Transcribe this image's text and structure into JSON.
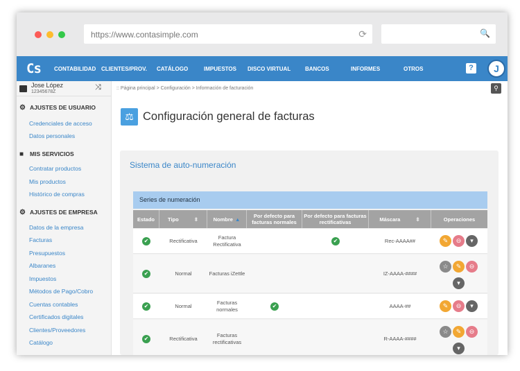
{
  "browser": {
    "url": "https://www.contasimple.com"
  },
  "nav": {
    "logo": "Cs",
    "items": [
      "CONTABILIDAD",
      "CLIENTES/PROV.",
      "CATÁLOGO",
      "IMPUESTOS",
      "DISCO VIRTUAL",
      "BANCOS",
      "INFORMES",
      "OTROS"
    ],
    "help": "?",
    "avatar": "J"
  },
  "user": {
    "name": "Jose López",
    "id": "12345678Z"
  },
  "sidebar": {
    "s1": "AJUSTES DE USUARIO",
    "s1_items": [
      "Credenciales de acceso",
      "Datos personales"
    ],
    "s2": "MIS SERVICIOS",
    "s2_items": [
      "Contratar productos",
      "Mis productos",
      "Histórico de compras"
    ],
    "s3": "AJUSTES DE EMPRESA",
    "s3_items": [
      "Datos de la empresa",
      "Facturas",
      "Presupuestos",
      "Albaranes",
      "Impuestos",
      "Métodos de Pago/Cobro",
      "Cuentas contables",
      "Certificados digitales",
      "Clientes/Proveedores",
      "Catálogo"
    ]
  },
  "breadcrumb": ":: Página principal > Configuración > Información de facturación",
  "page_title": "Configuración general de facturas",
  "panel": {
    "title": "Sistema de auto-numeración",
    "table_title": "Series de numeración",
    "headers": [
      "Estado",
      "Tipo",
      "Nombre",
      "Por defecto para facturas normales",
      "Por defecto para facturas rectificativas",
      "Máscara",
      "Operaciones"
    ],
    "rows": [
      {
        "tipo": "Rectificativa",
        "nombre": "Factura Rectificativa",
        "default_normal": false,
        "default_rect": true,
        "mascara": "Rec-AAAA##"
      },
      {
        "tipo": "Normal",
        "nombre": "Facturas iZettle",
        "default_normal": false,
        "default_rect": false,
        "mascara": "IZ-AAAA-####"
      },
      {
        "tipo": "Normal",
        "nombre": "Facturas normales",
        "default_normal": true,
        "default_rect": false,
        "mascara": "AAAA-##"
      },
      {
        "tipo": "Rectificativa",
        "nombre": "Facturas rectificativas",
        "default_normal": false,
        "default_rect": false,
        "mascara": "R-AAAA-####"
      }
    ]
  },
  "colors": {
    "nav": "#3a86c8",
    "accent": "#3a86c8",
    "success": "#3aa050",
    "edit": "#f2a733"
  }
}
